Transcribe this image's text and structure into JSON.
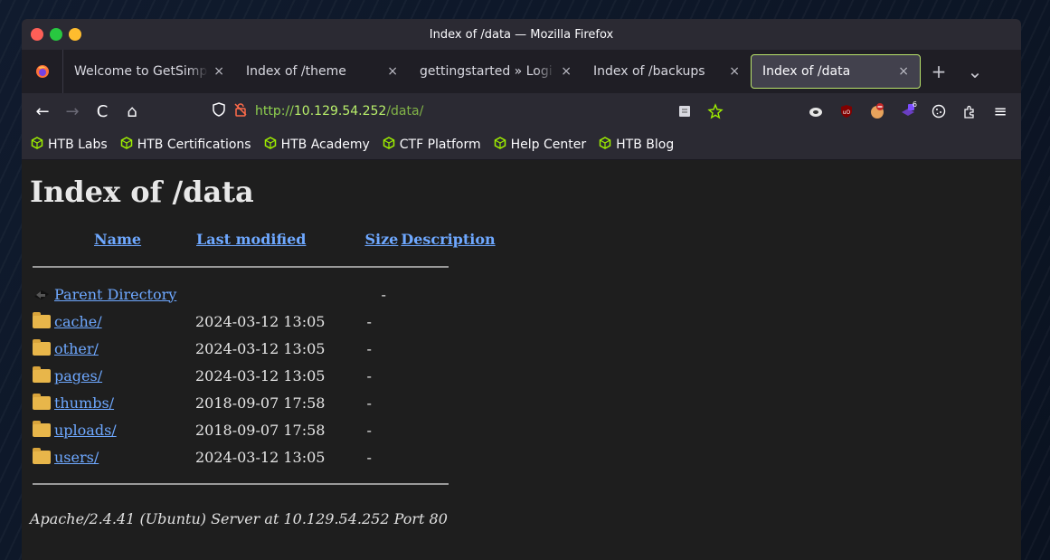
{
  "window": {
    "title": "Index of /data — Mozilla Firefox"
  },
  "tabs": [
    {
      "label": "Welcome to GetSimp",
      "close": "×",
      "active": false
    },
    {
      "label": "Index of /theme",
      "close": "×",
      "active": false
    },
    {
      "label": "gettingstarted » Logi",
      "close": "×",
      "active": false
    },
    {
      "label": "Index of /backups",
      "close": "×",
      "active": false
    },
    {
      "label": "Index of /data",
      "close": "×",
      "active": true
    }
  ],
  "tabbar": {
    "new_tab": "+",
    "list_tabs": "⌄"
  },
  "navbar": {
    "back": "←",
    "forward": "→",
    "reload": "C",
    "home": "⌂",
    "url_scheme": "http://",
    "url_host": "10.129.54.252",
    "url_path": "/data/",
    "menu": "≡"
  },
  "bookmarks": [
    {
      "label": "HTB Labs",
      "icon": "hexagon-cube-icon"
    },
    {
      "label": "HTB Certifications",
      "icon": "hexagon-cube-icon"
    },
    {
      "label": "HTB Academy",
      "icon": "hexagon-cube-icon"
    },
    {
      "label": "CTF Platform",
      "icon": "hexagon-cube-icon"
    },
    {
      "label": "Help Center",
      "icon": "hexagon-cube-icon"
    },
    {
      "label": "HTB Blog",
      "icon": "hexagon-cube-icon"
    }
  ],
  "page": {
    "heading": "Index of /data",
    "columns": {
      "name": "Name",
      "modified": "Last modified",
      "size": "Size",
      "description": "Description"
    },
    "parent": {
      "name": "Parent Directory",
      "size": "-"
    },
    "rows": [
      {
        "name": "cache/",
        "modified": "2024-03-12 13:05",
        "size": "-"
      },
      {
        "name": "other/",
        "modified": "2024-03-12 13:05",
        "size": "-"
      },
      {
        "name": "pages/",
        "modified": "2024-03-12 13:05",
        "size": "-"
      },
      {
        "name": "thumbs/",
        "modified": "2018-09-07 17:58",
        "size": "-"
      },
      {
        "name": "uploads/",
        "modified": "2018-09-07 17:58",
        "size": "-"
      },
      {
        "name": "users/",
        "modified": "2024-03-12 13:05",
        "size": "-"
      }
    ],
    "address": "Apache/2.4.41 (Ubuntu) Server at 10.129.54.252 Port 80"
  },
  "extension_badge": "6",
  "colors": {
    "accent": "#b9e36b",
    "link": "#6ea8ff",
    "url": "#8fd14f",
    "htb_green": "#9fef00"
  }
}
